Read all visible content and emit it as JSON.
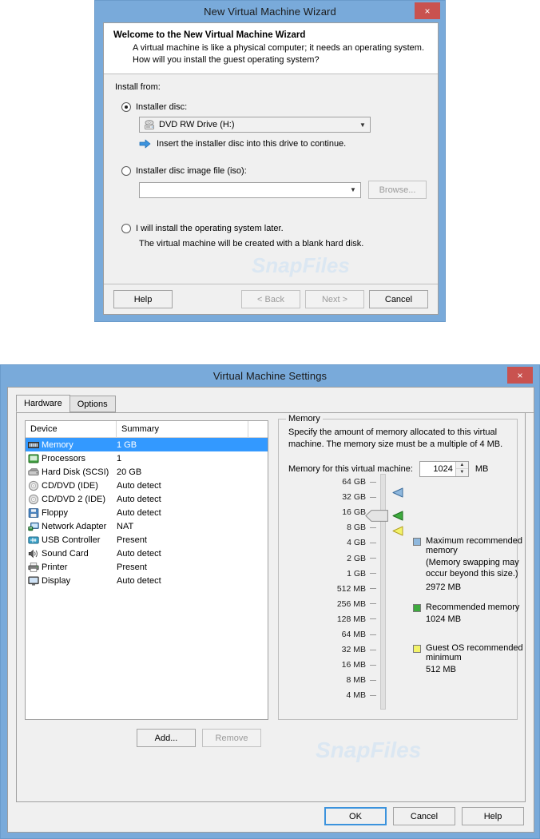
{
  "wizard": {
    "title": "New Virtual Machine Wizard",
    "close_label": "×",
    "banner_heading": "Welcome to the New Virtual Machine Wizard",
    "banner_text": "A virtual machine is like a physical computer; it needs an operating system. How will you install the guest operating system?",
    "install_from_label": "Install from:",
    "option_disc_label": "Installer disc:",
    "disc_combo_value": "DVD RW Drive (H:)",
    "disc_hint": "Insert the installer disc into this drive to continue.",
    "option_iso_label": "Installer disc image file (iso):",
    "iso_combo_value": "",
    "browse_label": "Browse...",
    "option_later_label": "I will install the operating system later.",
    "later_sub_label": "The virtual machine will be created with a blank hard disk.",
    "buttons": {
      "help": "Help",
      "back": "< Back",
      "next": "Next >",
      "cancel": "Cancel"
    },
    "watermark": "SnapFiles"
  },
  "settings": {
    "title": "Virtual Machine Settings",
    "close_label": "×",
    "tabs": [
      {
        "label": "Hardware",
        "active": true
      },
      {
        "label": "Options",
        "active": false
      }
    ],
    "device_columns": [
      "Device",
      "Summary"
    ],
    "devices": [
      {
        "name": "Memory",
        "summary": "1 GB",
        "icon": "memory-icon",
        "selected": true
      },
      {
        "name": "Processors",
        "summary": "1",
        "icon": "processor-icon",
        "selected": false
      },
      {
        "name": "Hard Disk (SCSI)",
        "summary": "20 GB",
        "icon": "harddisk-icon",
        "selected": false
      },
      {
        "name": "CD/DVD (IDE)",
        "summary": "Auto detect",
        "icon": "cddvd-icon",
        "selected": false
      },
      {
        "name": "CD/DVD 2 (IDE)",
        "summary": "Auto detect",
        "icon": "cddvd-icon",
        "selected": false
      },
      {
        "name": "Floppy",
        "summary": "Auto detect",
        "icon": "floppy-icon",
        "selected": false
      },
      {
        "name": "Network Adapter",
        "summary": "NAT",
        "icon": "network-adapter-icon",
        "selected": false
      },
      {
        "name": "USB Controller",
        "summary": "Present",
        "icon": "usb-icon",
        "selected": false
      },
      {
        "name": "Sound Card",
        "summary": "Auto detect",
        "icon": "sound-card-icon",
        "selected": false
      },
      {
        "name": "Printer",
        "summary": "Present",
        "icon": "printer-icon",
        "selected": false
      },
      {
        "name": "Display",
        "summary": "Auto detect",
        "icon": "display-icon",
        "selected": false
      }
    ],
    "add_label": "Add...",
    "remove_label": "Remove",
    "memory": {
      "group_title": "Memory",
      "description": "Specify the amount of memory allocated to this virtual machine. The memory size must be a multiple of 4 MB.",
      "field_label": "Memory for this virtual machine:",
      "value": "1024",
      "unit": "MB",
      "scale": [
        "64 GB",
        "32 GB",
        "16 GB",
        "8 GB",
        "4 GB",
        "2 GB",
        "1 GB",
        "512 MB",
        "256 MB",
        "128 MB",
        "64 MB",
        "32 MB",
        "16 MB",
        "8 MB",
        "4 MB"
      ],
      "legend": [
        {
          "label": "Maximum recommended memory",
          "note": "(Memory swapping may occur beyond this size.)",
          "value": "2972 MB",
          "color": "#8fb8dd"
        },
        {
          "label": "Recommended memory",
          "note": "",
          "value": "1024 MB",
          "color": "#3eaa3e"
        },
        {
          "label": "Guest OS recommended minimum",
          "note": "",
          "value": "512 MB",
          "color": "#f3f36a"
        }
      ]
    },
    "buttons": {
      "ok": "OK",
      "cancel": "Cancel",
      "help": "Help"
    },
    "watermark": "SnapFiles"
  },
  "chart_data": {
    "type": "table",
    "title": "VMware Virtual Machine Settings - Hardware",
    "categories": [
      "Memory",
      "Processors",
      "Hard Disk (SCSI)",
      "CD/DVD (IDE)",
      "CD/DVD 2 (IDE)",
      "Floppy",
      "Network Adapter",
      "USB Controller",
      "Sound Card",
      "Printer",
      "Display"
    ],
    "values": [
      "1 GB",
      "1",
      "20 GB",
      "Auto detect",
      "Auto detect",
      "Auto detect",
      "NAT",
      "Present",
      "Auto detect",
      "Present",
      "Auto detect"
    ]
  }
}
